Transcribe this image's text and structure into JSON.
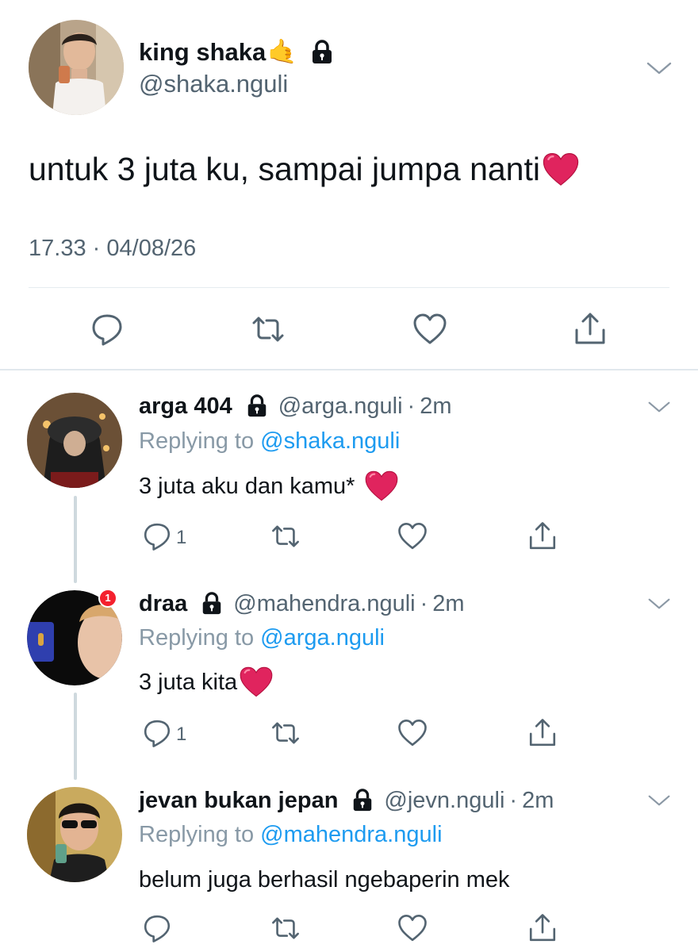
{
  "main": {
    "display_name": "king shaka",
    "handle": "@shaka.nguli",
    "text": "untuk 3 juta ku, sampai jumpa nanti",
    "time": "17.33",
    "date": "04/08/26",
    "meta_separator": "·",
    "hand_emoji": "🤙"
  },
  "replies": [
    {
      "display_name": "arga 404",
      "handle": "@arga.nguli",
      "time": "2m",
      "replying_prefix": "Replying to",
      "replying_to": "@shaka.nguli",
      "text": "3 juta aku dan kamu*",
      "reply_count": "1"
    },
    {
      "display_name": "draa",
      "handle": "@mahendra.nguli",
      "time": "2m",
      "replying_prefix": "Replying to",
      "replying_to": "@arga.nguli",
      "text": "3 juta kita",
      "reply_count": "1",
      "avatar_badge": "1"
    },
    {
      "display_name": "jevan bukan jepan",
      "handle": "@jevn.nguli",
      "time": "2m",
      "replying_prefix": "Replying to",
      "replying_to": "@mahendra.nguli",
      "text": "belum juga berhasil ngebaperin mek"
    }
  ],
  "separator": "·",
  "icons": [
    "lock-icon",
    "chevron-down-icon",
    "reply-icon",
    "retweet-icon",
    "like-icon",
    "share-icon",
    "heart-emoji-icon"
  ],
  "colors": {
    "text": "#0f1419",
    "secondary": "#536471",
    "link": "#1d9bf0",
    "heart": "#e0245e",
    "divider": "#e6ecf0"
  }
}
